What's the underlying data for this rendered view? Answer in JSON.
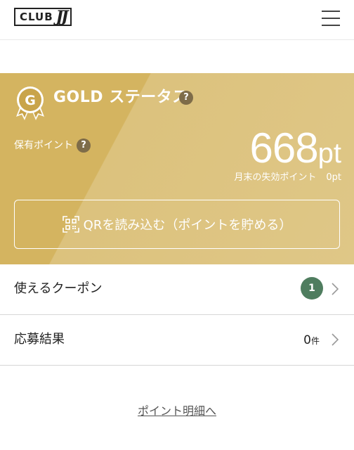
{
  "header": {
    "logo_text": "CLUB",
    "logo_mark": "JJ",
    "menu_icon": "hamburger-menu-icon"
  },
  "status_card": {
    "medal_icon": "gold-medal-icon",
    "medal_letter": "G",
    "status_label": "GOLD ステータス",
    "help_glyph": "?",
    "points_label": "保有ポイント",
    "points_value": "668",
    "points_unit": "pt",
    "expiring_label": "月末の失効ポイント",
    "expiring_value": "0pt",
    "qr_icon": "qr-scan-icon",
    "qr_button_label": "QRを読み込む（ポイントを貯める）",
    "colors": {
      "gold_dark": "#d4b460",
      "gold_light": "#dfc787",
      "help_bg": "#7e6c49"
    }
  },
  "list": {
    "coupon": {
      "label": "使えるクーポン",
      "badge_count": "1",
      "badge_color": "#4f7d5f"
    },
    "results": {
      "label": "応募結果",
      "count": "0",
      "count_unit": "件"
    }
  },
  "footer": {
    "details_link": "ポイント明細へ"
  }
}
